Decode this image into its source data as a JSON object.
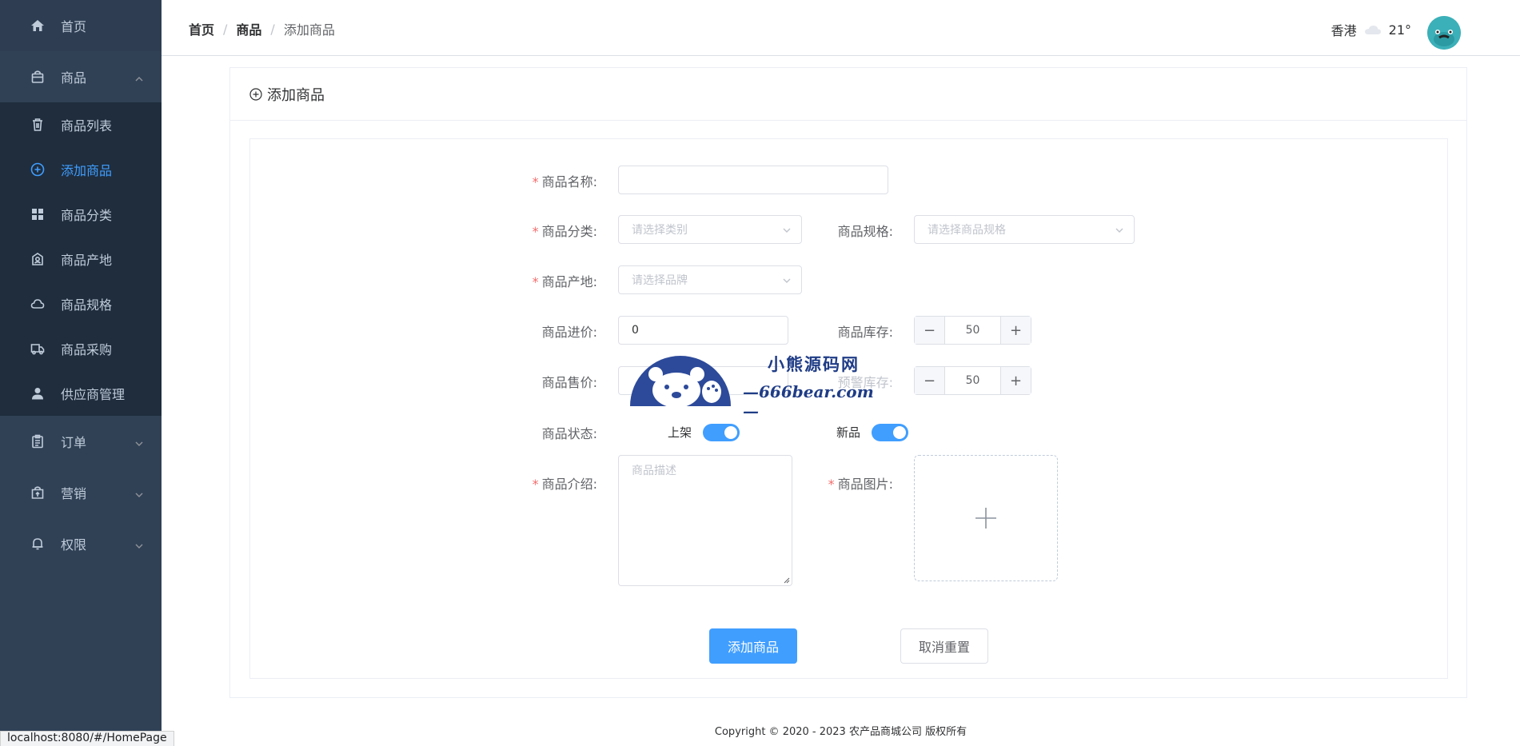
{
  "sidebar": {
    "home": "首页",
    "goods": "商品",
    "goods_items": [
      "商品列表",
      "添加商品",
      "商品分类",
      "商品产地",
      "商品规格",
      "商品采购",
      "供应商管理"
    ],
    "order": "订单",
    "marketing": "营销",
    "permission": "权限",
    "active_color": "#409eff"
  },
  "header": {
    "breadcrumb": [
      "首页",
      "商品",
      "添加商品"
    ],
    "city": "香港",
    "temperature": "21°"
  },
  "card": {
    "title": "添加商品"
  },
  "form": {
    "name_label": "商品名称:",
    "category_label": "商品分类:",
    "category_placeholder": "请选择类别",
    "spec_label": "商品规格:",
    "spec_placeholder": "请选择商品规格",
    "origin_label": "商品产地:",
    "origin_placeholder": "请选择品牌",
    "purchase_price_label": "商品进价:",
    "purchase_price_value": "0",
    "stock_label": "商品库存:",
    "stock_value": "50",
    "sale_price_label": "商品售价:",
    "warn_stock_label": "预警库存:",
    "warn_stock_value": "50",
    "status_label": "商品状态:",
    "on_shelf_label": "上架",
    "new_label": "新品",
    "intro_label": "商品介绍:",
    "intro_placeholder": "商品描述",
    "image_label": "商品图片:",
    "submit_label": "添加商品",
    "reset_label": "取消重置"
  },
  "watermark": {
    "cn": "小熊源码网",
    "en": "—666bear.com—"
  },
  "footer": "Copyright © 2020 - 2023  农产品商城公司 版权所有",
  "statusbar": "localhost:8080/#/HomePage"
}
